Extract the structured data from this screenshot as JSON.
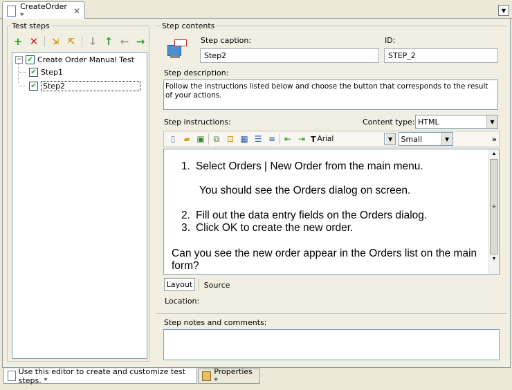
{
  "document_tab": {
    "title": "CreateOrder *",
    "close_glyph": "✕"
  },
  "test_steps": {
    "group_label": "Test steps",
    "toolbar": [
      "add-icon",
      "delete-icon",
      "import-icon",
      "export-icon",
      "move-down-icon",
      "move-up-icon",
      "move-left-icon",
      "move-right-icon"
    ],
    "tree": {
      "root": "Create Order Manual Test",
      "children": [
        "Step1",
        "Step2"
      ]
    }
  },
  "step_contents": {
    "group_label": "Step contents",
    "caption_label": "Step caption:",
    "caption_value": "Step2",
    "id_label": "ID:",
    "id_value": "STEP_2",
    "description_label": "Step description:",
    "description_value": "Follow the instructions listed below and choose the button that corresponds to the result of your actions.",
    "instructions_label": "Step instructions:",
    "content_type_label": "Content type:",
    "content_type_value": "HTML",
    "font_name": "Arial",
    "font_size": "Small",
    "more_glyph": "»",
    "instructions": {
      "item1": "Select Orders | New Order from the main menu.",
      "item1_note": "You should see the Orders dialog on screen.",
      "item2": "Fill out the data entry fields on the Orders dialog.",
      "item3": "Click OK to create the new order.",
      "question": "Can you see the new order appear in the Orders list on the main form?"
    },
    "view_tabs": {
      "layout": "Layout",
      "source": "Source"
    },
    "location_label": "Location:",
    "notes_label": "Step notes and comments:",
    "notes_value": ""
  },
  "bottom_tabs": {
    "editor_tab": "Use this editor to create and customize test steps. *",
    "properties_tab": "Properties *"
  },
  "colors": {
    "add": "#21a121",
    "delete": "#d21f1f",
    "arrow_disabled": "#9a9a9a",
    "arrow_enabled": "#2f9a2f"
  }
}
